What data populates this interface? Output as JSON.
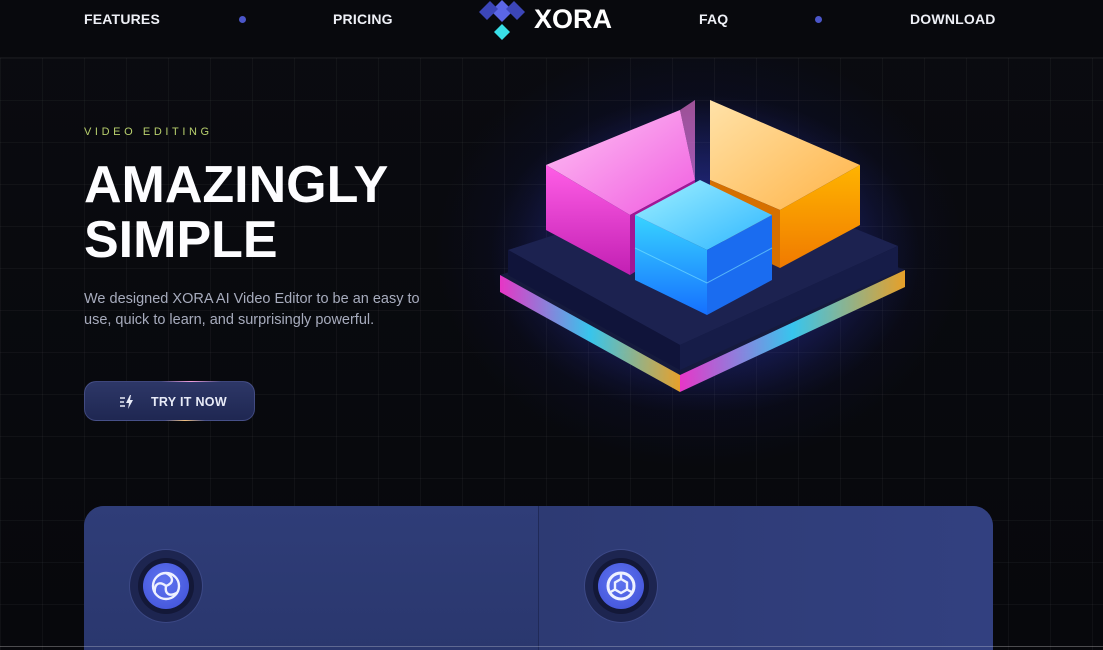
{
  "nav": {
    "links": [
      "FEATURES",
      "PRICING",
      "FAQ",
      "DOWNLOAD"
    ],
    "logo_text": "XORA",
    "accent": "#4b56c9"
  },
  "hero": {
    "eyebrow": "VIDEO EDITING",
    "headline_line1": "AMAZINGLY",
    "headline_line2": "SIMPLE",
    "description": "We designed XORA AI Video Editor to be an easy to use, quick to learn, and surprisingly powerful.",
    "cta_label": "TRY IT NOW",
    "cta_icon": "zap-icon",
    "eyebrow_color": "#b8cf6d"
  },
  "features": {
    "icons": [
      "spiral-icon",
      "hexagon-ring-icon"
    ],
    "card_color": "#2f3d78"
  }
}
